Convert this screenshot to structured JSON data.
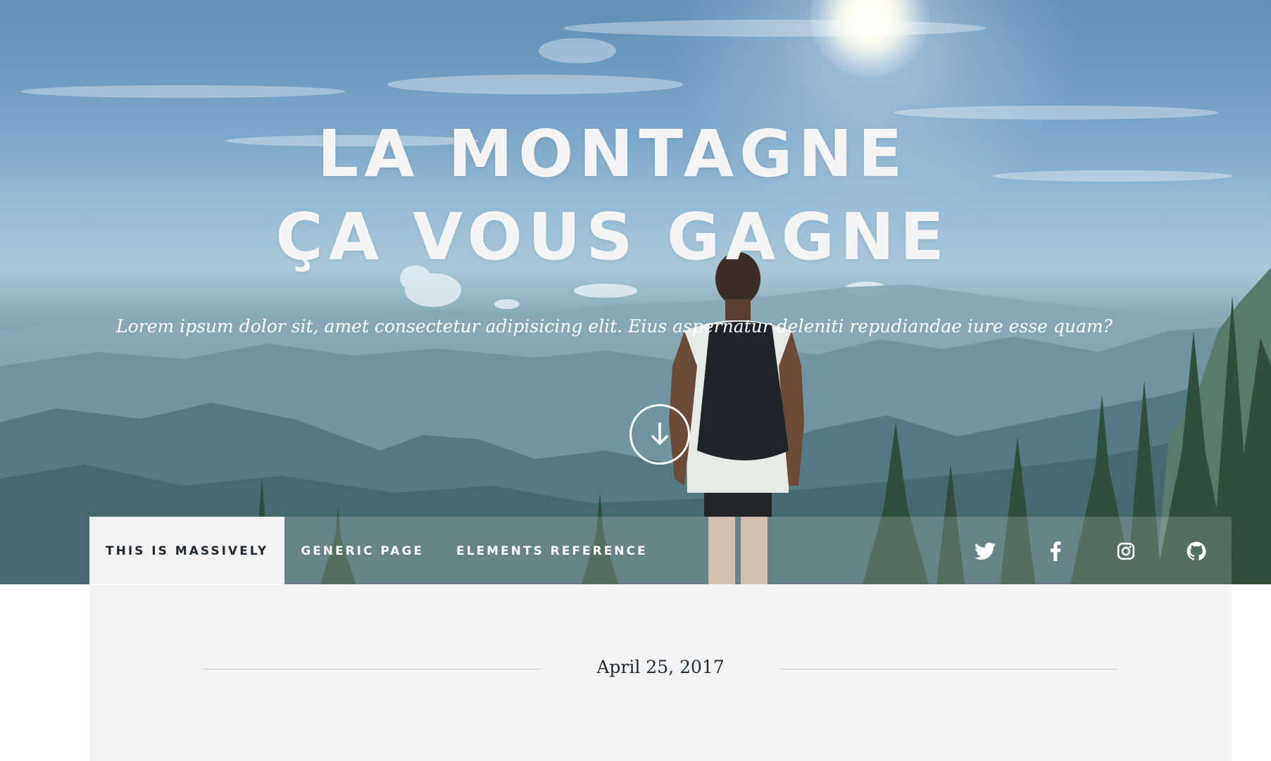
{
  "hero": {
    "title_line1": "LA MONTAGNE",
    "title_line2": "ÇA VOUS GAGNE",
    "subtitle": "Lorem ipsum dolor sit, amet consectetur adipisicing elit. Eius aspernatur deleniti repudiandae iure esse quam?",
    "scroll_icon": "arrow-down-icon"
  },
  "nav": {
    "links": [
      {
        "label": "THIS IS MASSIVELY",
        "active": true
      },
      {
        "label": "GENERIC PAGE",
        "active": false
      },
      {
        "label": "ELEMENTS REFERENCE",
        "active": false
      }
    ],
    "social": [
      {
        "icon": "twitter-icon"
      },
      {
        "icon": "facebook-icon"
      },
      {
        "icon": "instagram-icon"
      },
      {
        "icon": "github-icon"
      }
    ]
  },
  "main": {
    "date": "April 25, 2017"
  },
  "colors": {
    "text_light": "#ffffff",
    "panel_bg": "#f3f3f3",
    "text_dark": "#212931",
    "rule": "#c9c9c9"
  }
}
